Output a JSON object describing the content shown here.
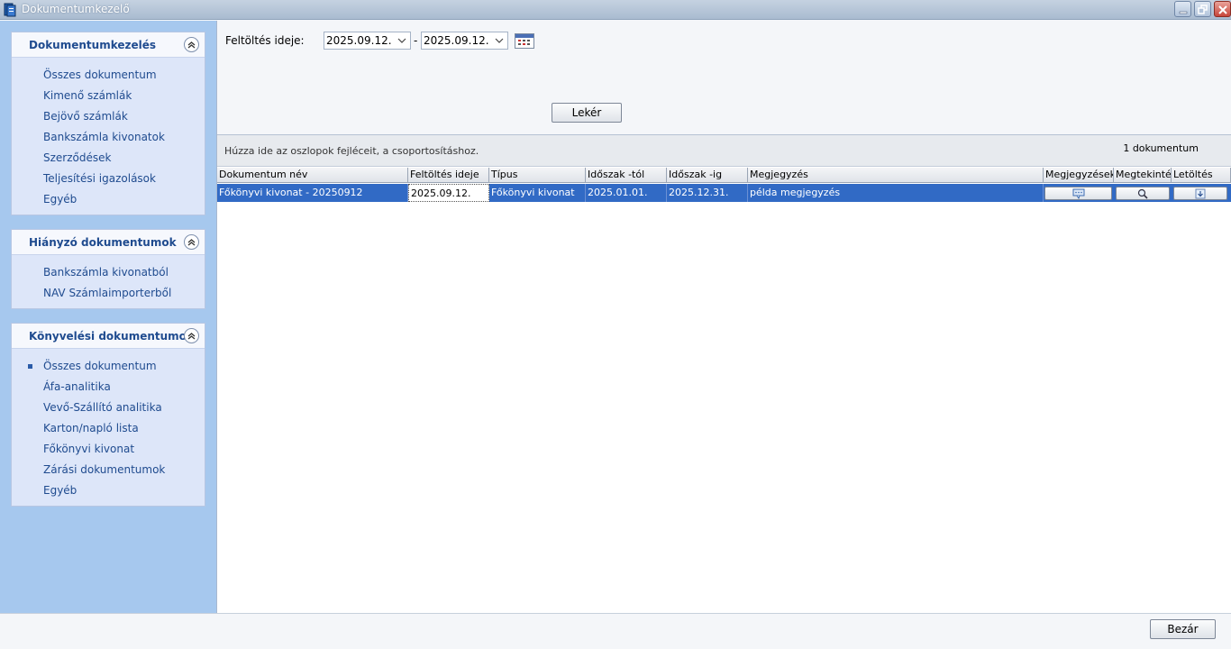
{
  "window": {
    "title": "Dokumentumkezelő"
  },
  "sidebar": {
    "panels": [
      {
        "title": "Dokumentumkezelés",
        "items": [
          "Összes dokumentum",
          "Kimenő számlák",
          "Bejövő számlák",
          "Bankszámla kivonatok",
          "Szerződések",
          "Teljesítési igazolások",
          "Egyéb"
        ]
      },
      {
        "title": "Hiányzó dokumentumok",
        "items": [
          "Bankszámla kivonatból",
          "NAV Számlaimporterből"
        ]
      },
      {
        "title": "Könyvelési dokumentumok",
        "items": [
          "Összes dokumentum",
          "Áfa-analitika",
          "Vevő-Szállító analitika",
          "Karton/napló lista",
          "Főkönyvi kivonat",
          "Zárási dokumentumok",
          "Egyéb"
        ],
        "selected_index": 0
      }
    ]
  },
  "filter": {
    "label": "Feltöltés ideje:",
    "date_from": "2025.09.12.",
    "separator": "-",
    "date_to": "2025.09.12.",
    "query_button": "Lekér"
  },
  "grid": {
    "group_hint": "Húzza ide az oszlopok fejléceit, a csoportosításhoz.",
    "count": "1 dokumentum",
    "columns": [
      "Dokumentum név",
      "Feltöltés ideje",
      "Típus",
      "Időszak -tól",
      "Időszak -ig",
      "Megjegyzés",
      "Megjegyzések",
      "Megtekintés",
      "Letöltés"
    ],
    "rows": [
      {
        "name": "Főkönyvi kivonat - 20250912",
        "uploaded": "2025.09.12.",
        "type": "Főkönyvi kivonat",
        "from": "2025.01.01.",
        "to": "2025.12.31.",
        "note": "példa megjegyzés"
      }
    ]
  },
  "footer": {
    "close_button": "Bezár"
  },
  "colors": {
    "sidebar_bg": "#a6c8ee",
    "panel_title": "#1f4b8f",
    "row_selected": "#316ac5"
  }
}
